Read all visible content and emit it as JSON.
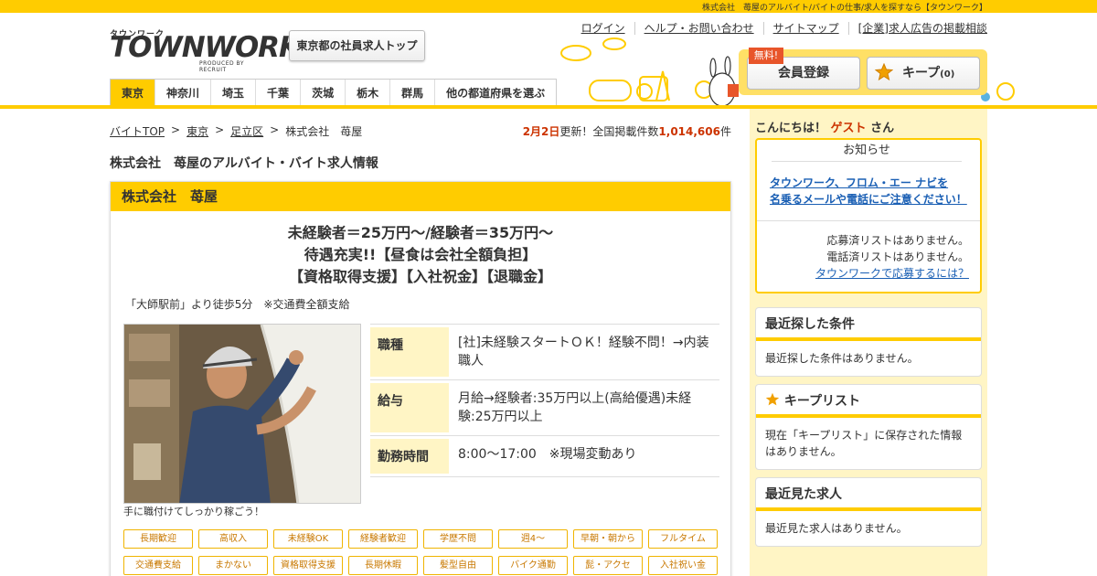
{
  "topbar": {
    "text": "株式会社　苺屋のアルバイト/バイトの仕事/求人を探すなら【タウンワーク】"
  },
  "logo": {
    "kana": "タウンワーク",
    "main": "TOWNWORK",
    "sub": "PRODUCED BY RECRUIT"
  },
  "header": {
    "top_button": "東京都の社員求人トップ",
    "util_links": [
      "ログイン",
      "ヘルプ・お問い合わせ",
      "サイトマップ",
      "[企業]求人広告の掲載相談"
    ],
    "free_badge": "無料!",
    "member_button": "会員登録",
    "keep_button": "キープ",
    "keep_count": "(0)"
  },
  "region_tabs": [
    "東京",
    "神奈川",
    "埼玉",
    "千葉",
    "茨城",
    "栃木",
    "群馬",
    "他の都道府県を選ぶ"
  ],
  "breadcrumb": {
    "items": [
      "バイトTOP",
      "東京",
      "足立区"
    ],
    "current": "株式会社　苺屋",
    "sep": ">"
  },
  "updated": {
    "date": "2月2日",
    "text": "更新！全国掲載件数",
    "count": "1,014,606",
    "unit": "件"
  },
  "page_title": "株式会社　苺屋のアルバイト・バイト求人情報",
  "job": {
    "company": "株式会社　苺屋",
    "catch_lines": [
      "未経験者＝25万円～/経験者＝35万円～",
      "待遇充実!!【昼食は会社全額負担】",
      "【資格取得支援】【入社祝金】【退職金】"
    ],
    "access": "「大師駅前」より徒歩5分　※交通費全額支給",
    "caption": "手に職付けてしっかり稼ごう！",
    "rows": [
      {
        "label": "職種",
        "value": "[社]未経験スタートＯＫ！経験不問！→内装職人"
      },
      {
        "label": "給与",
        "value": "月給→経験者:35万円以上(高給優遇)未経験:25万円以上"
      },
      {
        "label": "勤務時間",
        "value": "8:00～17:00　※現場変動あり"
      }
    ],
    "tags": [
      "長期歓迎",
      "高収入",
      "未経験OK",
      "経験者歓迎",
      "学歴不問",
      "週4～",
      "早朝・朝から",
      "フルタイム",
      "交通費支給",
      "まかない",
      "資格取得支援",
      "長期休暇",
      "髪型自由",
      "バイク通勤",
      "髭・アクセ",
      "入社祝い金"
    ]
  },
  "sidebar": {
    "greeting_prefix": "こんにちは！",
    "guest": "ゲスト",
    "greeting_suffix": "さん",
    "notice_title": "お知らせ",
    "notice_link_1": "タウンワーク、フロム・エー ナビを",
    "notice_link_2": "名乗るメールや電話にご注意ください！",
    "applied_status": "応募済リストはありません。",
    "called_status": "電話済リストはありません。",
    "how_to_apply": "タウンワークで応募するには？",
    "recent_search_title": "最近探した条件",
    "recent_search_body": "最近探した条件はありません。",
    "keep_list_title": "キープリスト",
    "keep_list_body": "現在「キープリスト」に保存された情報はありません。",
    "recent_viewed_title": "最近見た求人",
    "recent_viewed_body": "最近見た求人はありません。"
  },
  "colors": {
    "brand_yellow": "#ffcc00",
    "accent_red": "#cc3300",
    "link_blue": "#1a5fb4"
  }
}
